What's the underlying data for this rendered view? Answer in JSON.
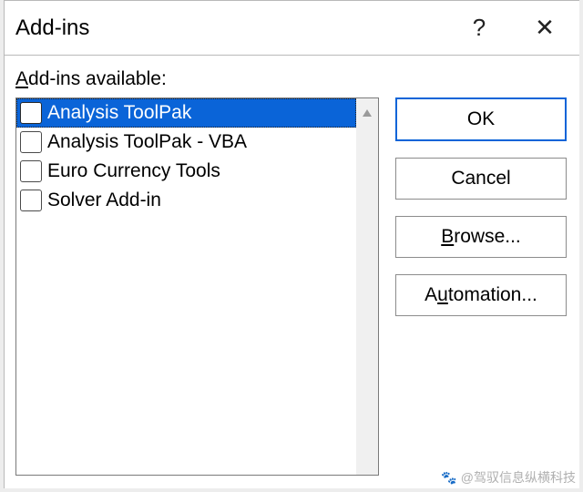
{
  "dialog": {
    "title": "Add-ins",
    "help": "?",
    "close": "✕"
  },
  "label": {
    "pre": "A",
    "rest": "dd-ins available:"
  },
  "addins": {
    "items": [
      {
        "label": "Analysis ToolPak",
        "selected": true
      },
      {
        "label": "Analysis ToolPak - VBA",
        "selected": false
      },
      {
        "label": "Euro Currency Tools",
        "selected": false
      },
      {
        "label": "Solver Add-in",
        "selected": false
      }
    ]
  },
  "buttons": {
    "ok": "OK",
    "cancel": "Cancel",
    "browse_pre": "B",
    "browse_rest": "rowse...",
    "automation_pre": "A",
    "automation_mid": "u",
    "automation_rest": "tomation..."
  },
  "watermark": "@驾驭信息纵横科技"
}
